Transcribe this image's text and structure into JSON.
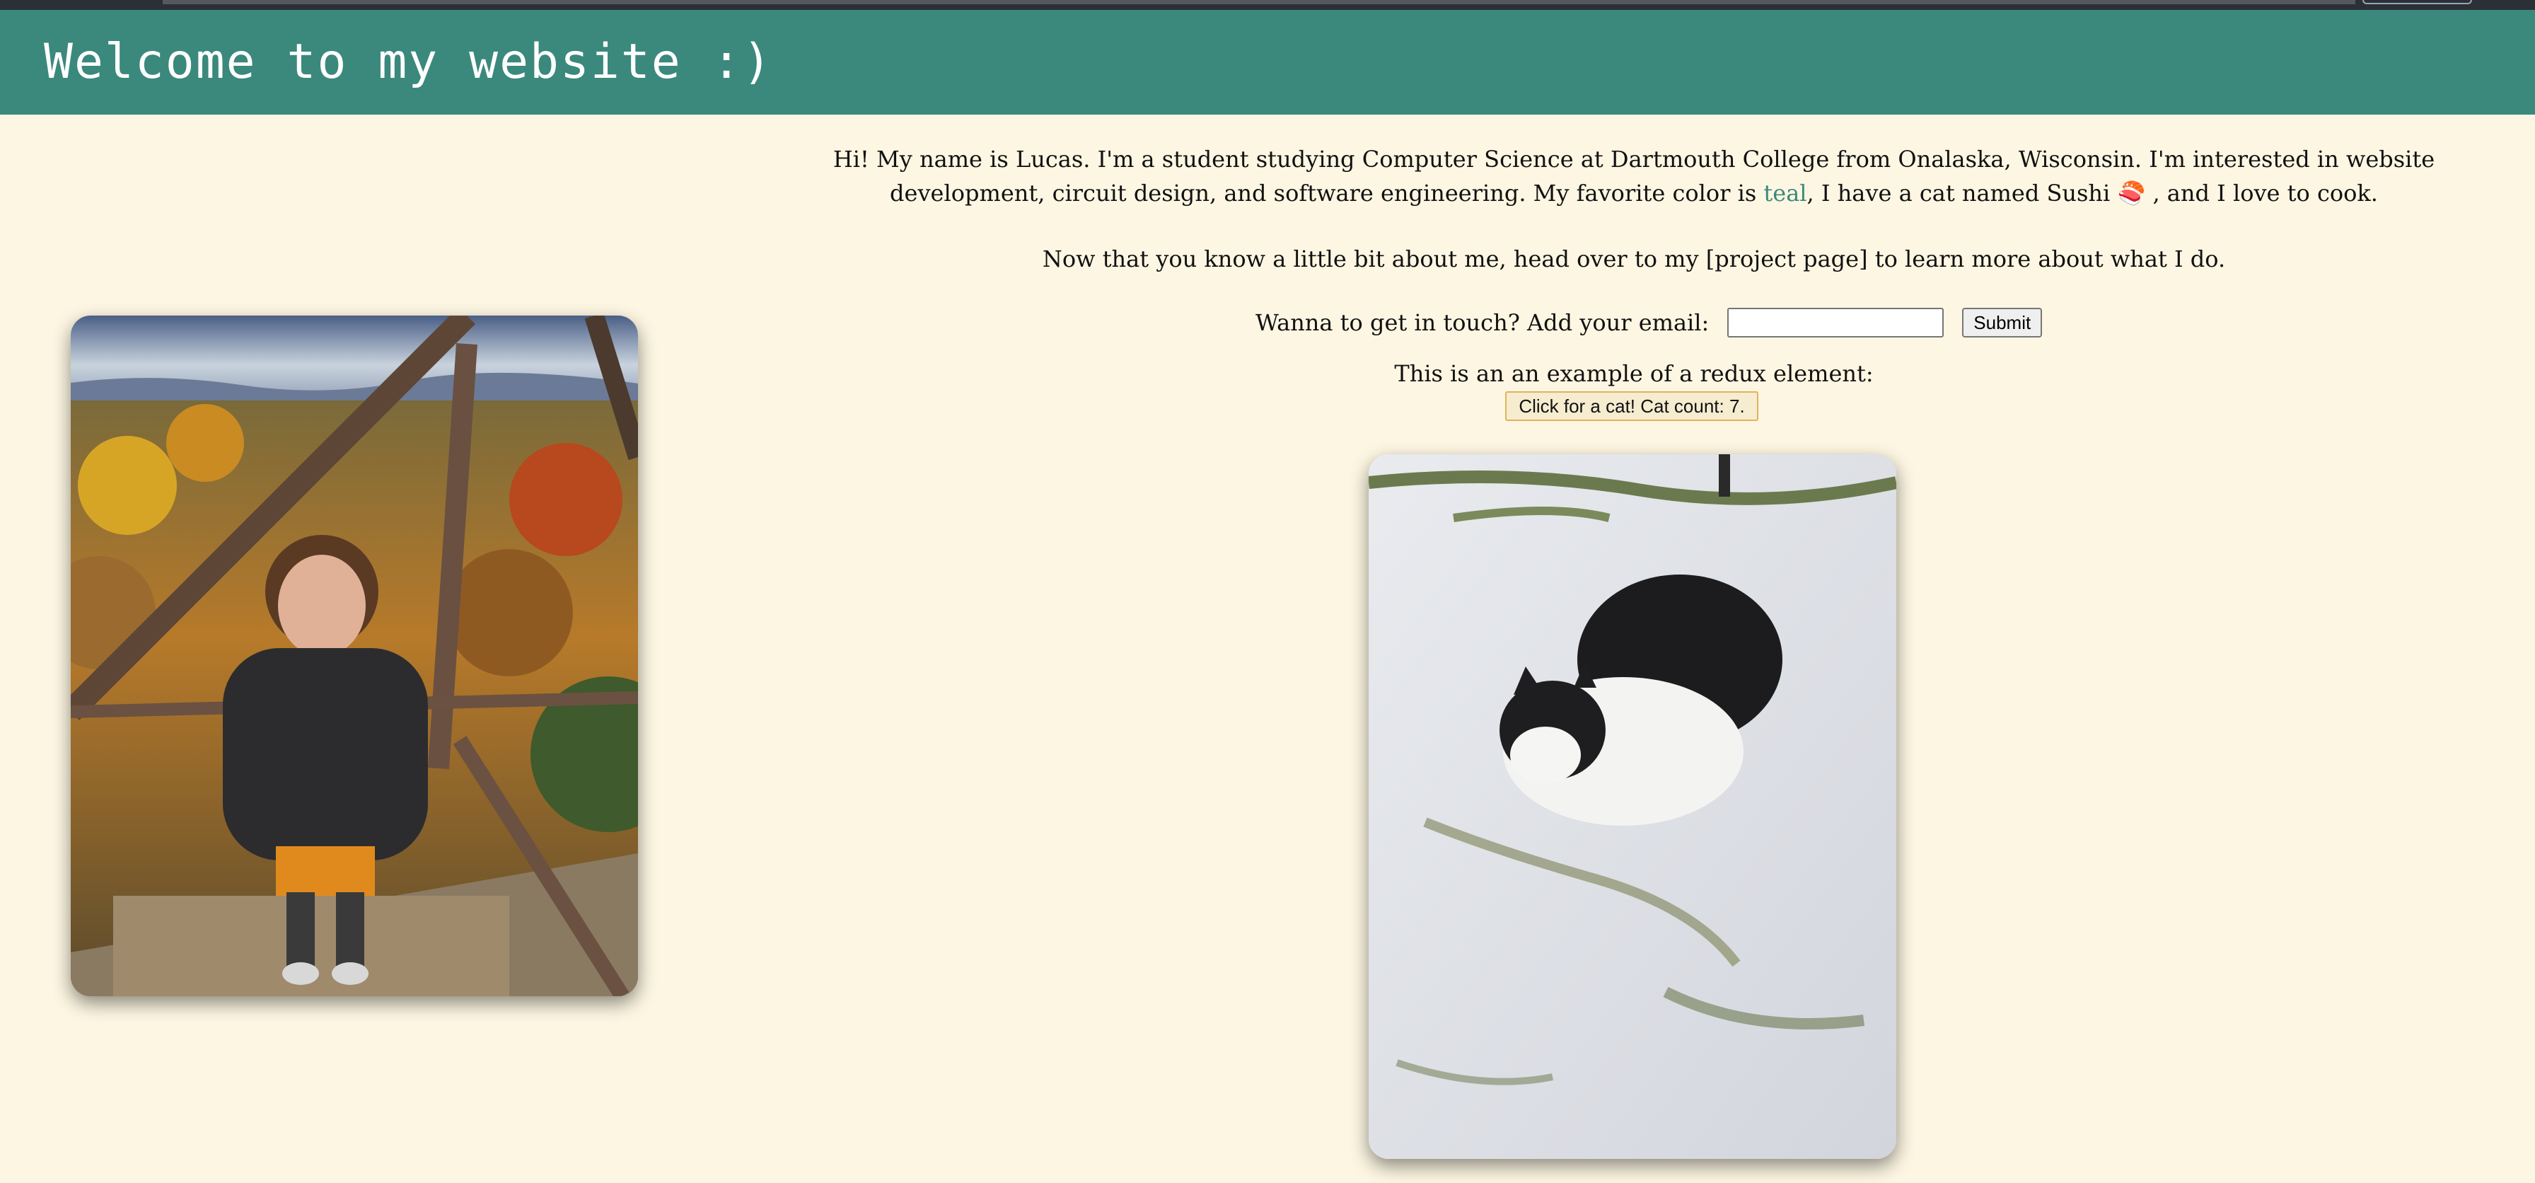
{
  "header": {
    "title": "Welcome to my website :)"
  },
  "intro": {
    "part1": "Hi! My name is Lucas. I'm a student studying Computer Science at Dartmouth College from Onalaska, Wisconsin. I'm interested in website development, circuit design, and software engineering. My favorite color is ",
    "color_word": "teal",
    "part2": ", I have a cat named Sushi ",
    "emoji": "🍣",
    "part3": " , and I love to cook."
  },
  "nav_line": {
    "text_before": "Now that you know a little bit about me, head over to my ",
    "link": "[project page]",
    "text_after": " to learn more about what I do."
  },
  "contact": {
    "label": "Wanna to get in touch? Add your email:",
    "email_value": "",
    "submit_label": "Submit"
  },
  "redux": {
    "label": "This is an an example of a redux element:",
    "button_label": "Click for a cat! Cat count: 7."
  },
  "images": {
    "portrait": "photo-of-lucas-on-lookout-tower",
    "cat": "photo-of-black-and-white-cat-in-snow"
  },
  "colors": {
    "accent": "#3a897c",
    "background": "#fdf6e2",
    "header_text": "#ffffff"
  }
}
